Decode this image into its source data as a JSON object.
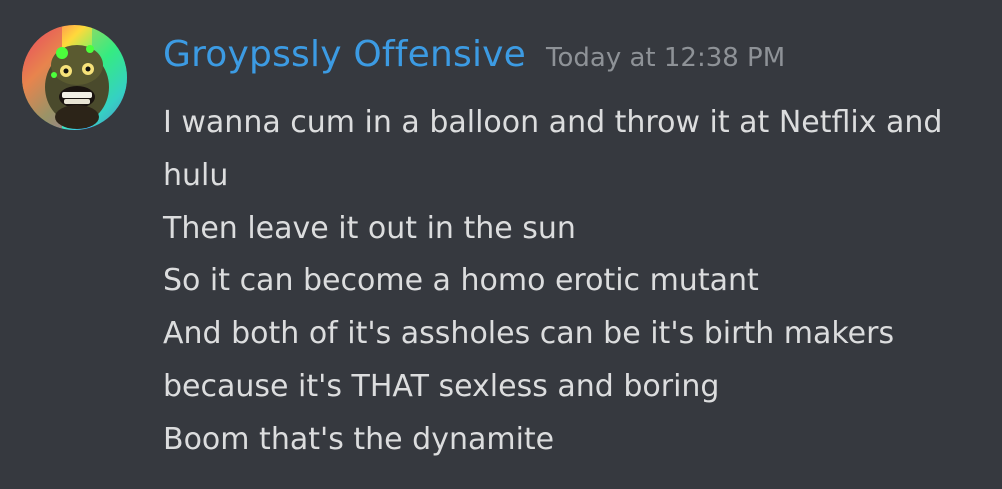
{
  "message": {
    "username": "Groypssly Offensive",
    "timestamp": "Today at 12:38 PM",
    "lines": [
      "I wanna cum in a balloon and throw it at Netflix and",
      "hulu",
      "Then leave it out in the sun",
      "So it can become a homo erotic mutant",
      "And both of it's assholes can be it's birth makers",
      "because it's THAT sexless and boring",
      "Boom that's the dynamite"
    ]
  },
  "colors": {
    "background": "#36393f",
    "username": "#3c9be3",
    "timestamp": "#8e9297",
    "text": "#dcddde"
  },
  "icons": {
    "avatar": "avatar-image"
  }
}
